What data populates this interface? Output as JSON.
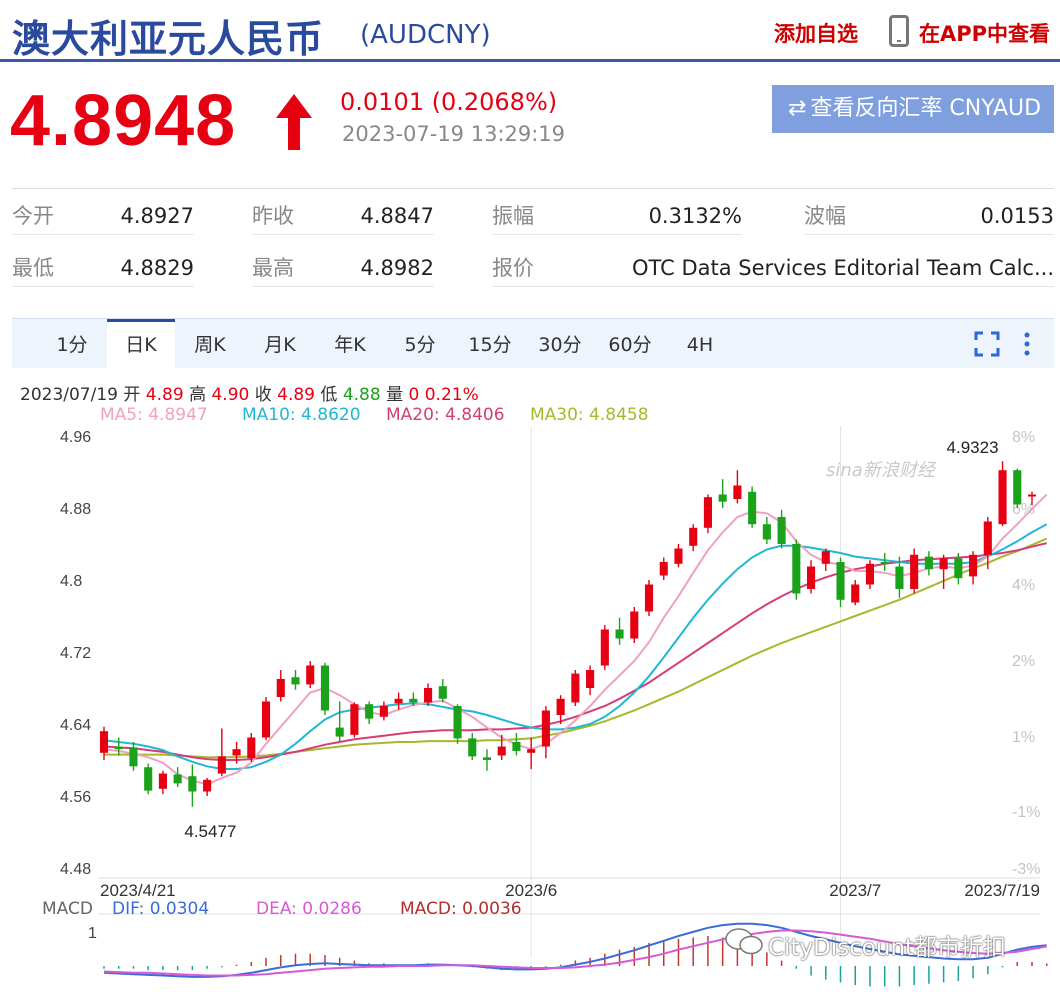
{
  "header": {
    "title": "澳大利亚元人民币",
    "code": "(AUDCNY)",
    "add_favorite": "添加自选",
    "view_in_app": "在APP中查看"
  },
  "quote": {
    "price": "4.8948",
    "change": "0.0101 (0.2068%)",
    "time": "2023-07-19 13:29:19",
    "reverse_button": "查看反向汇率 CNYAUD"
  },
  "stats": [
    {
      "label": "今开",
      "value": "4.8927"
    },
    {
      "label": "昨收",
      "value": "4.8847"
    },
    {
      "label": "振幅",
      "value": "0.3132%"
    },
    {
      "label": "波幅",
      "value": "0.0153"
    },
    {
      "label": "最低",
      "value": "4.8829"
    },
    {
      "label": "最高",
      "value": "4.8982"
    },
    {
      "label": "报价",
      "value": "OTC Data Services Editorial Team Calc..."
    }
  ],
  "tabs": [
    "1分",
    "日K",
    "周K",
    "月K",
    "年K",
    "5分",
    "15分",
    "30分",
    "60分",
    "4H"
  ],
  "active_tab": "日K",
  "ohlc": {
    "date": "2023/07/19",
    "open_label": "开",
    "open": "4.89",
    "high_label": "高",
    "high": "4.90",
    "close_label": "收",
    "close": "4.89",
    "low_label": "低",
    "low": "4.88",
    "vol_label": "量",
    "vol": "0",
    "pct": "0.21%"
  },
  "ma": [
    {
      "label": "MA5: 4.8947",
      "color": "#f0a0c0"
    },
    {
      "label": "MA10: 4.8620",
      "color": "#22b6d6"
    },
    {
      "label": "MA20: 4.8406",
      "color": "#d63c78"
    },
    {
      "label": "MA30: 4.8458",
      "color": "#a8b82a"
    }
  ],
  "macd": {
    "title": "MACD",
    "dif": "DIF: 0.0304",
    "dea": "DEA: 0.0286",
    "macd": "MACD: 0.0036",
    "axis_label": "1"
  },
  "watermark": "CityDiscount都市折扣",
  "sina_logo": "sina新浪财经",
  "colors": {
    "up": "#e60012",
    "down": "#1aa31a",
    "brand": "#2a4a9e"
  },
  "chart_data": {
    "type": "candlestick",
    "title": "",
    "ylim": [
      4.48,
      4.96
    ],
    "y_ticks": [
      "4.96",
      "4.88",
      "4.8",
      "4.72",
      "4.64",
      "4.56",
      "4.48"
    ],
    "y2_ticks": [
      "8%",
      "6%",
      "4%",
      "2%",
      "1%",
      "-1%",
      "-3%"
    ],
    "x_labels": [
      "2023/4/21",
      "2023/6",
      "2023/7",
      "2023/7/19"
    ],
    "annotations": [
      {
        "text": "4.9323",
        "x": "2023/7/17",
        "y": 4.9323
      },
      {
        "text": "4.5477",
        "x": "2023/5/1",
        "y": 4.5477
      }
    ],
    "candles": [
      {
        "date": "2023/4/21",
        "o": 4.608,
        "h": 4.637,
        "l": 4.6,
        "c": 4.632
      },
      {
        "date": "2023/4/24",
        "o": 4.615,
        "h": 4.625,
        "l": 4.605,
        "c": 4.612
      },
      {
        "date": "2023/4/25",
        "o": 4.614,
        "h": 4.62,
        "l": 4.588,
        "c": 4.593
      },
      {
        "date": "2023/4/26",
        "o": 4.592,
        "h": 4.596,
        "l": 4.562,
        "c": 4.566
      },
      {
        "date": "2023/4/27",
        "o": 4.568,
        "h": 4.588,
        "l": 4.562,
        "c": 4.585
      },
      {
        "date": "2023/4/28",
        "o": 4.584,
        "h": 4.592,
        "l": 4.57,
        "c": 4.574
      },
      {
        "date": "2023/5/1",
        "o": 4.582,
        "h": 4.595,
        "l": 4.548,
        "c": 4.565
      },
      {
        "date": "2023/5/2",
        "o": 4.565,
        "h": 4.58,
        "l": 4.56,
        "c": 4.578
      },
      {
        "date": "2023/5/3",
        "o": 4.585,
        "h": 4.635,
        "l": 4.582,
        "c": 4.604
      },
      {
        "date": "2023/5/4",
        "o": 4.605,
        "h": 4.62,
        "l": 4.596,
        "c": 4.612
      },
      {
        "date": "2023/5/5",
        "o": 4.602,
        "h": 4.63,
        "l": 4.598,
        "c": 4.625
      },
      {
        "date": "2023/5/8",
        "o": 4.625,
        "h": 4.67,
        "l": 4.622,
        "c": 4.665
      },
      {
        "date": "2023/5/9",
        "o": 4.67,
        "h": 4.7,
        "l": 4.665,
        "c": 4.69
      },
      {
        "date": "2023/5/10",
        "o": 4.692,
        "h": 4.7,
        "l": 4.678,
        "c": 4.684
      },
      {
        "date": "2023/5/11",
        "o": 4.684,
        "h": 4.71,
        "l": 4.68,
        "c": 4.705
      },
      {
        "date": "2023/5/12",
        "o": 4.705,
        "h": 4.708,
        "l": 4.65,
        "c": 4.655
      },
      {
        "date": "2023/5/15",
        "o": 4.636,
        "h": 4.665,
        "l": 4.62,
        "c": 4.626
      },
      {
        "date": "2023/5/16",
        "o": 4.628,
        "h": 4.664,
        "l": 4.625,
        "c": 4.662
      },
      {
        "date": "2023/5/17",
        "o": 4.662,
        "h": 4.665,
        "l": 4.64,
        "c": 4.646
      },
      {
        "date": "2023/5/18",
        "o": 4.648,
        "h": 4.665,
        "l": 4.644,
        "c": 4.66
      },
      {
        "date": "2023/5/19",
        "o": 4.663,
        "h": 4.675,
        "l": 4.656,
        "c": 4.668
      },
      {
        "date": "2023/5/22",
        "o": 4.668,
        "h": 4.675,
        "l": 4.66,
        "c": 4.664
      },
      {
        "date": "2023/5/23",
        "o": 4.664,
        "h": 4.685,
        "l": 4.66,
        "c": 4.68
      },
      {
        "date": "2023/5/24",
        "o": 4.682,
        "h": 4.69,
        "l": 4.664,
        "c": 4.668
      },
      {
        "date": "2023/5/25",
        "o": 4.66,
        "h": 4.662,
        "l": 4.618,
        "c": 4.624
      },
      {
        "date": "2023/5/26",
        "o": 4.624,
        "h": 4.63,
        "l": 4.6,
        "c": 4.604
      },
      {
        "date": "2023/5/29",
        "o": 4.603,
        "h": 4.612,
        "l": 4.588,
        "c": 4.6
      },
      {
        "date": "2023/5/30",
        "o": 4.605,
        "h": 4.628,
        "l": 4.6,
        "c": 4.615
      },
      {
        "date": "2023/5/31",
        "o": 4.62,
        "h": 4.63,
        "l": 4.605,
        "c": 4.61
      },
      {
        "date": "2023/6/1",
        "o": 4.608,
        "h": 4.625,
        "l": 4.59,
        "c": 4.612
      },
      {
        "date": "2023/6/2",
        "o": 4.615,
        "h": 4.66,
        "l": 4.602,
        "c": 4.655
      },
      {
        "date": "2023/6/5",
        "o": 4.65,
        "h": 4.672,
        "l": 4.64,
        "c": 4.668
      },
      {
        "date": "2023/6/6",
        "o": 4.664,
        "h": 4.7,
        "l": 4.66,
        "c": 4.696
      },
      {
        "date": "2023/6/7",
        "o": 4.68,
        "h": 4.705,
        "l": 4.672,
        "c": 4.7
      },
      {
        "date": "2023/6/8",
        "o": 4.705,
        "h": 4.75,
        "l": 4.7,
        "c": 4.745
      },
      {
        "date": "2023/6/9",
        "o": 4.745,
        "h": 4.758,
        "l": 4.728,
        "c": 4.735
      },
      {
        "date": "2023/6/12",
        "o": 4.735,
        "h": 4.77,
        "l": 4.73,
        "c": 4.765
      },
      {
        "date": "2023/6/13",
        "o": 4.765,
        "h": 4.8,
        "l": 4.76,
        "c": 4.795
      },
      {
        "date": "2023/6/14",
        "o": 4.805,
        "h": 4.825,
        "l": 4.8,
        "c": 4.82
      },
      {
        "date": "2023/6/15",
        "o": 4.818,
        "h": 4.84,
        "l": 4.814,
        "c": 4.835
      },
      {
        "date": "2023/6/16",
        "o": 4.838,
        "h": 4.862,
        "l": 4.832,
        "c": 4.858
      },
      {
        "date": "2023/6/19",
        "o": 4.858,
        "h": 4.895,
        "l": 4.852,
        "c": 4.892
      },
      {
        "date": "2023/6/20",
        "o": 4.895,
        "h": 4.912,
        "l": 4.88,
        "c": 4.887
      },
      {
        "date": "2023/6/21",
        "o": 4.89,
        "h": 4.922,
        "l": 4.885,
        "c": 4.905
      },
      {
        "date": "2023/6/22",
        "o": 4.898,
        "h": 4.904,
        "l": 4.858,
        "c": 4.862
      },
      {
        "date": "2023/6/23",
        "o": 4.862,
        "h": 4.87,
        "l": 4.84,
        "c": 4.845
      },
      {
        "date": "2023/6/26",
        "o": 4.87,
        "h": 4.878,
        "l": 4.835,
        "c": 4.84
      },
      {
        "date": "2023/6/27",
        "o": 4.84,
        "h": 4.845,
        "l": 4.778,
        "c": 4.785
      },
      {
        "date": "2023/6/28",
        "o": 4.79,
        "h": 4.822,
        "l": 4.785,
        "c": 4.815
      },
      {
        "date": "2023/6/29",
        "o": 4.818,
        "h": 4.835,
        "l": 4.81,
        "c": 4.832
      },
      {
        "date": "2023/6/30",
        "o": 4.82,
        "h": 4.825,
        "l": 4.77,
        "c": 4.778
      },
      {
        "date": "2023/7/3",
        "o": 4.775,
        "h": 4.8,
        "l": 4.772,
        "c": 4.795
      },
      {
        "date": "2023/7/4",
        "o": 4.795,
        "h": 4.822,
        "l": 4.79,
        "c": 4.818
      },
      {
        "date": "2023/7/5",
        "o": 4.82,
        "h": 4.83,
        "l": 4.81,
        "c": 4.818
      },
      {
        "date": "2023/7/6",
        "o": 4.815,
        "h": 4.826,
        "l": 4.78,
        "c": 4.79
      },
      {
        "date": "2023/7/7",
        "o": 4.79,
        "h": 4.835,
        "l": 4.785,
        "c": 4.828
      },
      {
        "date": "2023/7/10",
        "o": 4.826,
        "h": 4.832,
        "l": 4.805,
        "c": 4.812
      },
      {
        "date": "2023/7/11",
        "o": 4.812,
        "h": 4.828,
        "l": 4.79,
        "c": 4.824
      },
      {
        "date": "2023/7/12",
        "o": 4.824,
        "h": 4.83,
        "l": 4.795,
        "c": 4.802
      },
      {
        "date": "2023/7/13",
        "o": 4.804,
        "h": 4.832,
        "l": 4.795,
        "c": 4.828
      },
      {
        "date": "2023/7/14",
        "o": 4.828,
        "h": 4.87,
        "l": 4.812,
        "c": 4.865
      },
      {
        "date": "2023/7/17",
        "o": 4.862,
        "h": 4.932,
        "l": 4.86,
        "c": 4.922
      },
      {
        "date": "2023/7/18",
        "o": 4.922,
        "h": 4.924,
        "l": 4.88,
        "c": 4.884
      },
      {
        "date": "2023/7/19",
        "o": 4.893,
        "h": 4.898,
        "l": 4.883,
        "c": 4.895
      }
    ],
    "ma5": [
      4.612,
      4.61,
      4.607,
      4.603,
      4.597,
      4.584,
      4.577,
      4.573,
      4.58,
      4.586,
      4.597,
      4.618,
      4.637,
      4.656,
      4.675,
      4.68,
      4.672,
      4.662,
      4.653,
      4.65,
      4.656,
      4.661,
      4.664,
      4.666,
      4.657,
      4.648,
      4.636,
      4.625,
      4.617,
      4.612,
      4.618,
      4.63,
      4.644,
      4.66,
      4.678,
      4.694,
      4.71,
      4.731,
      4.758,
      4.782,
      4.808,
      4.833,
      4.853,
      4.87,
      4.876,
      4.874,
      4.864,
      4.843,
      4.828,
      4.82,
      4.817,
      4.81,
      4.81,
      4.808,
      4.804,
      4.808,
      4.813,
      4.815,
      4.813,
      4.816,
      4.826,
      4.846,
      4.862,
      4.879,
      4.895
    ],
    "ma10": [
      4.622,
      4.62,
      4.618,
      4.615,
      4.611,
      4.604,
      4.598,
      4.593,
      4.59,
      4.59,
      4.592,
      4.598,
      4.606,
      4.618,
      4.632,
      4.645,
      4.653,
      4.656,
      4.658,
      4.66,
      4.662,
      4.663,
      4.662,
      4.659,
      4.656,
      4.654,
      4.65,
      4.645,
      4.64,
      4.636,
      4.634,
      4.634,
      4.636,
      4.64,
      4.648,
      4.66,
      4.675,
      4.693,
      4.714,
      4.736,
      4.758,
      4.778,
      4.796,
      4.812,
      4.825,
      4.834,
      4.838,
      4.838,
      4.836,
      4.833,
      4.83,
      4.826,
      4.824,
      4.822,
      4.82,
      4.818,
      4.818,
      4.818,
      4.818,
      4.82,
      4.826,
      4.834,
      4.843,
      4.853,
      4.862
    ],
    "ma20": [
      4.615,
      4.614,
      4.613,
      4.611,
      4.609,
      4.606,
      4.603,
      4.601,
      4.6,
      4.6,
      4.601,
      4.603,
      4.606,
      4.609,
      4.613,
      4.617,
      4.62,
      4.623,
      4.625,
      4.627,
      4.629,
      4.631,
      4.632,
      4.633,
      4.633,
      4.633,
      4.634,
      4.634,
      4.635,
      4.636,
      4.639,
      4.643,
      4.648,
      4.654,
      4.66,
      4.668,
      4.677,
      4.686,
      4.697,
      4.708,
      4.719,
      4.73,
      4.741,
      4.752,
      4.763,
      4.773,
      4.782,
      4.79,
      4.797,
      4.803,
      4.808,
      4.812,
      4.815,
      4.818,
      4.82,
      4.822,
      4.823,
      4.824,
      4.825,
      4.826,
      4.828,
      4.83,
      4.833,
      4.837,
      4.841
    ],
    "ma30": [
      4.606,
      4.606,
      4.606,
      4.606,
      4.606,
      4.605,
      4.604,
      4.603,
      4.603,
      4.603,
      4.604,
      4.605,
      4.607,
      4.609,
      4.611,
      4.613,
      4.615,
      4.617,
      4.618,
      4.619,
      4.62,
      4.62,
      4.621,
      4.621,
      4.621,
      4.621,
      4.622,
      4.622,
      4.623,
      4.624,
      4.627,
      4.63,
      4.634,
      4.638,
      4.643,
      4.649,
      4.655,
      4.662,
      4.669,
      4.676,
      4.684,
      4.692,
      4.7,
      4.708,
      4.716,
      4.723,
      4.73,
      4.736,
      4.742,
      4.748,
      4.754,
      4.76,
      4.766,
      4.772,
      4.778,
      4.785,
      4.792,
      4.799,
      4.806,
      4.813,
      4.819,
      4.826,
      4.832,
      4.839,
      4.846
    ],
    "macd_dif": [
      -0.01,
      -0.011,
      -0.012,
      -0.013,
      -0.014,
      -0.015,
      -0.016,
      -0.016,
      -0.015,
      -0.013,
      -0.01,
      -0.006,
      -0.002,
      0.001,
      0.003,
      0.004,
      0.003,
      0.002,
      0.001,
      0.001,
      0.001,
      0.001,
      0.002,
      0.002,
      0.001,
      0.0,
      -0.002,
      -0.004,
      -0.005,
      -0.005,
      -0.004,
      -0.002,
      0.002,
      0.006,
      0.011,
      0.017,
      0.023,
      0.03,
      0.037,
      0.044,
      0.05,
      0.056,
      0.06,
      0.062,
      0.062,
      0.06,
      0.056,
      0.05,
      0.044,
      0.039,
      0.034,
      0.029,
      0.025,
      0.021,
      0.017,
      0.015,
      0.013,
      0.011,
      0.01,
      0.01,
      0.012,
      0.018,
      0.024,
      0.028,
      0.0304
    ],
    "macd_dea": [
      -0.008,
      -0.009,
      -0.01,
      -0.01,
      -0.011,
      -0.012,
      -0.013,
      -0.014,
      -0.014,
      -0.014,
      -0.013,
      -0.012,
      -0.01,
      -0.008,
      -0.006,
      -0.004,
      -0.003,
      -0.002,
      -0.001,
      -0.001,
      0.0,
      0.0,
      0.0,
      0.001,
      0.001,
      0.001,
      0.0,
      -0.001,
      -0.002,
      -0.003,
      -0.003,
      -0.003,
      -0.002,
      0.0,
      0.002,
      0.005,
      0.009,
      0.013,
      0.018,
      0.024,
      0.029,
      0.034,
      0.039,
      0.044,
      0.047,
      0.05,
      0.052,
      0.052,
      0.051,
      0.049,
      0.046,
      0.043,
      0.04,
      0.036,
      0.032,
      0.029,
      0.026,
      0.023,
      0.021,
      0.019,
      0.018,
      0.019,
      0.021,
      0.025,
      0.0286
    ]
  }
}
